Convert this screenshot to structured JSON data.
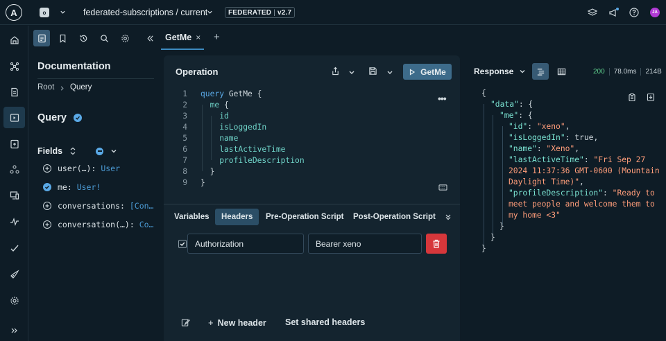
{
  "topbar": {
    "logo_letter": "A",
    "org_initial": "o",
    "graph_ref": "federated-subscriptions / current",
    "variant_label": "FEDERATED",
    "version": "v2.7",
    "avatar_initials": "JA",
    "accent_avatar_color": "#b13ad6"
  },
  "nav_icons": [
    "home-icon",
    "graph-icon",
    "document-icon",
    "explorer-icon",
    "schema-icon",
    "subgraphs-icon",
    "monitor-icon",
    "pulse-icon",
    "checks-icon",
    "launch-icon",
    "settings-icon",
    "expand-icon"
  ],
  "tab": {
    "name": "GetMe",
    "close": "×",
    "add": "+"
  },
  "docs": {
    "title": "Documentation",
    "crumb_root": "Root",
    "crumb_current": "Query",
    "type_title": "Query",
    "fields_label": "Fields",
    "fields": [
      {
        "name": "user(…): ",
        "type": "User",
        "checked": false
      },
      {
        "name": "me: ",
        "type": "User!",
        "checked": true
      },
      {
        "name": "conversations: ",
        "type": "[Con…",
        "checked": false
      },
      {
        "name": "conversation(…): ",
        "type": "Co…",
        "checked": false
      }
    ]
  },
  "operation": {
    "title": "Operation",
    "run_label": "GetMe",
    "more": "•••",
    "lines": [
      {
        "n": "1",
        "parts": [
          [
            "kw",
            "query "
          ],
          [
            "ident",
            "GetMe "
          ],
          [
            "brace",
            "{"
          ]
        ]
      },
      {
        "n": "2",
        "parts": [
          [
            "fld",
            "  me "
          ],
          [
            "brace",
            "{"
          ]
        ]
      },
      {
        "n": "3",
        "parts": [
          [
            "fld",
            "    id"
          ]
        ]
      },
      {
        "n": "4",
        "parts": [
          [
            "fld",
            "    isLoggedIn"
          ]
        ]
      },
      {
        "n": "5",
        "parts": [
          [
            "fld",
            "    name"
          ]
        ]
      },
      {
        "n": "6",
        "parts": [
          [
            "fld",
            "    lastActiveTime"
          ]
        ]
      },
      {
        "n": "7",
        "parts": [
          [
            "fld",
            "    profileDescription"
          ]
        ]
      },
      {
        "n": "8",
        "parts": [
          [
            "brace",
            "  }"
          ]
        ]
      },
      {
        "n": "9",
        "parts": [
          [
            "brace",
            "}"
          ]
        ]
      }
    ],
    "tabs": [
      "Variables",
      "Headers",
      "Pre-Operation Script",
      "Post-Operation Script"
    ],
    "active_tab": "Headers",
    "header_key": "Authorization",
    "header_value": "Bearer xeno",
    "new_header": "New header",
    "set_shared": "Set shared headers",
    "plus": "+"
  },
  "response": {
    "title": "Response",
    "status": "200",
    "time": "78.0ms",
    "size": "214B",
    "lines": [
      {
        "indent": 0,
        "parts": [
          [
            "jpunct",
            "{"
          ]
        ]
      },
      {
        "indent": 1,
        "parts": [
          [
            "jkey",
            "\"data\""
          ],
          [
            "jpunct",
            ": {"
          ]
        ]
      },
      {
        "indent": 2,
        "parts": [
          [
            "jkey",
            "\"me\""
          ],
          [
            "jpunct",
            ": {"
          ]
        ]
      },
      {
        "indent": 3,
        "parts": [
          [
            "jkey",
            "\"id\""
          ],
          [
            "jpunct",
            ": "
          ],
          [
            "jstr",
            "\"xeno\""
          ],
          [
            "jpunct",
            ","
          ]
        ]
      },
      {
        "indent": 3,
        "parts": [
          [
            "jkey",
            "\"isLoggedIn\""
          ],
          [
            "jpunct",
            ": "
          ],
          [
            "jbool",
            "true"
          ],
          [
            "jpunct",
            ","
          ]
        ]
      },
      {
        "indent": 3,
        "parts": [
          [
            "jkey",
            "\"name\""
          ],
          [
            "jpunct",
            ": "
          ],
          [
            "jstr",
            "\"Xeno\""
          ],
          [
            "jpunct",
            ","
          ]
        ]
      },
      {
        "indent": 3,
        "parts": [
          [
            "jkey",
            "\"lastActiveTime\""
          ],
          [
            "jpunct",
            ": "
          ],
          [
            "jstr",
            "\"Fri Sep 27"
          ]
        ]
      },
      {
        "indent": 3,
        "parts": [
          [
            "jstr",
            "2024 11:37:36 GMT-0600 (Mountain"
          ]
        ]
      },
      {
        "indent": 3,
        "parts": [
          [
            "jstr",
            "Daylight Time)\""
          ],
          [
            "jpunct",
            ","
          ]
        ]
      },
      {
        "indent": 3,
        "parts": [
          [
            "jkey",
            "\"profileDescription\""
          ],
          [
            "jpunct",
            ": "
          ],
          [
            "jstr",
            "\"Ready to"
          ]
        ]
      },
      {
        "indent": 3,
        "parts": [
          [
            "jstr",
            "meet people and welcome them to"
          ]
        ]
      },
      {
        "indent": 3,
        "parts": [
          [
            "jstr",
            "my home <3\""
          ]
        ]
      },
      {
        "indent": 2,
        "parts": [
          [
            "jpunct",
            "}"
          ]
        ]
      },
      {
        "indent": 1,
        "parts": [
          [
            "jpunct",
            "}"
          ]
        ]
      },
      {
        "indent": 0,
        "parts": [
          [
            "jpunct",
            "}"
          ]
        ]
      }
    ]
  }
}
